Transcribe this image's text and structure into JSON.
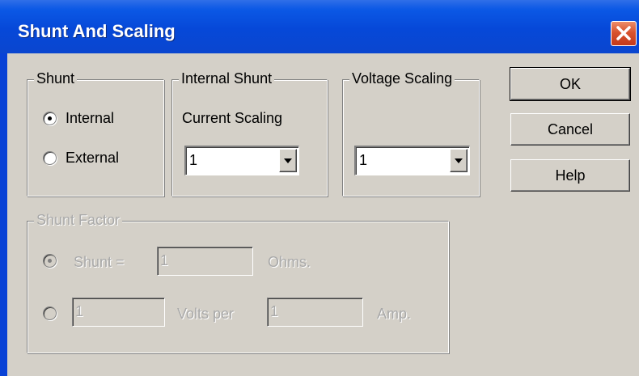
{
  "window": {
    "title": "Shunt And Scaling"
  },
  "shunt": {
    "legend": "Shunt",
    "options": [
      {
        "label": "Internal",
        "selected": true
      },
      {
        "label": "External",
        "selected": false
      }
    ]
  },
  "internal_shunt": {
    "legend": "Internal Shunt",
    "current_scaling_label": "Current Scaling",
    "current_scaling_value": "1"
  },
  "voltage_scaling": {
    "legend": "Voltage Scaling",
    "value": "1"
  },
  "buttons": {
    "ok": "OK",
    "cancel": "Cancel",
    "help": "Help"
  },
  "shunt_factor": {
    "legend": "Shunt Factor",
    "shunt_label": "Shunt =",
    "shunt_value": "1",
    "ohms_label": "Ohms.",
    "volts_value": "1",
    "volts_per_label": "Volts per",
    "amp_value": "1",
    "amp_label": "Amp."
  }
}
